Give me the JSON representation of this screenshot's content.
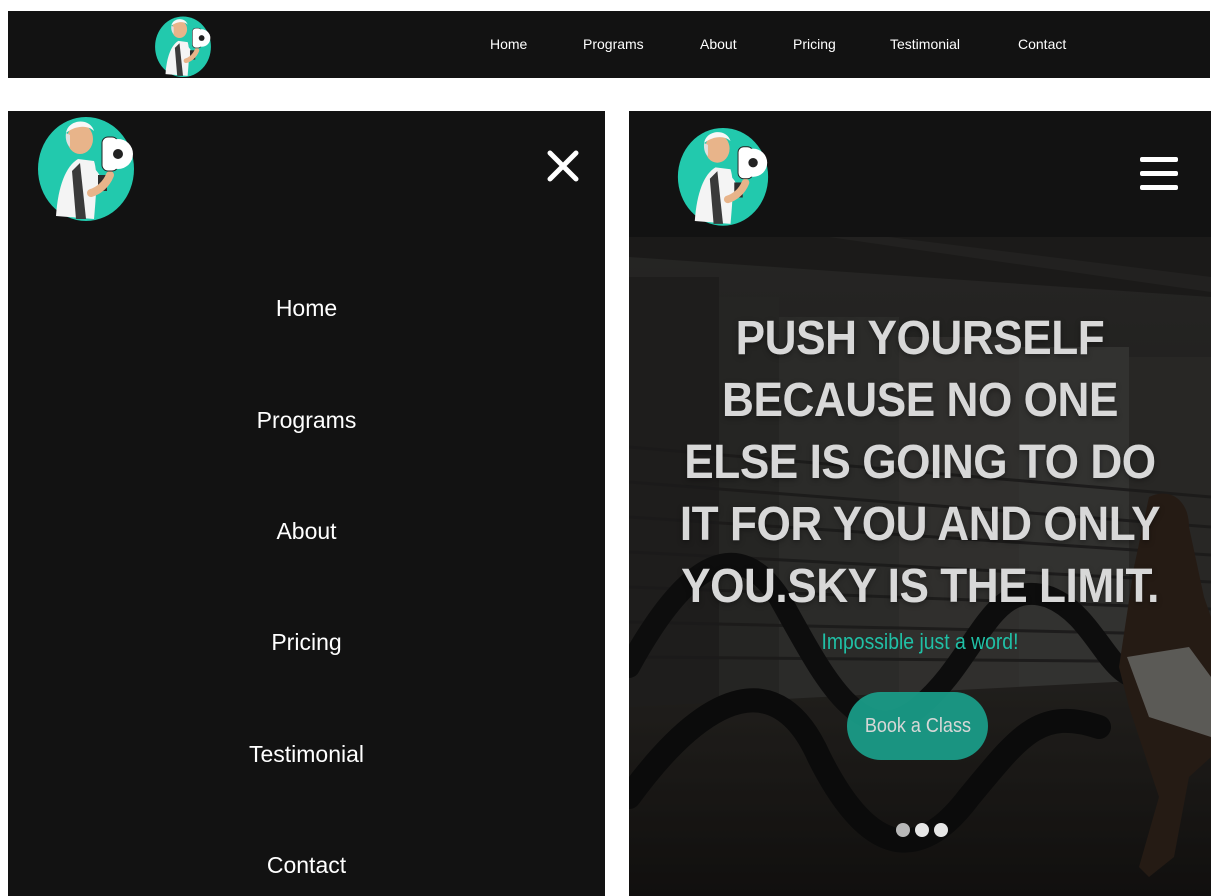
{
  "desktop_nav": {
    "links": [
      "Home",
      "Programs",
      "About",
      "Pricing",
      "Testimonial",
      "Contact"
    ]
  },
  "mobile_menu": {
    "items": [
      "Home",
      "Programs",
      "About",
      "Pricing",
      "Testimonial",
      "Contact"
    ],
    "close_icon": "close-icon"
  },
  "hero": {
    "menu_icon": "hamburger-icon",
    "title": "PUSH YOURSELF BECAUSE NO ONE ELSE IS GOING TO DO IT FOR YOU AND ONLY YOU.SKY IS THE LIMIT.",
    "subtitle": "Impossible just a word!",
    "cta_label": "Book a Class",
    "carousel": {
      "slides": 3,
      "active": 2
    }
  },
  "colors": {
    "nav_bg": "#121212",
    "accent": "#1a9f8a",
    "subtitle": "#20c0a6",
    "dot_inactive": "#b8b8b8",
    "dot_active": "#e6e6e6"
  }
}
